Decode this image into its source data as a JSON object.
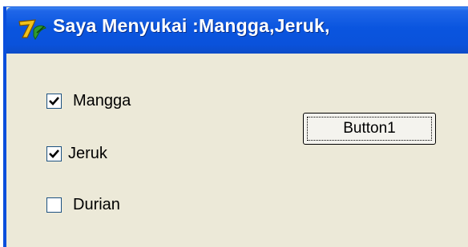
{
  "window": {
    "title": "Saya Menyukai :Mangga,Jeruk,",
    "icon": "delphi-app-icon"
  },
  "checkboxes": [
    {
      "label": "Mangga",
      "checked": true
    },
    {
      "label": "Jeruk",
      "checked": true
    },
    {
      "label": "Durian",
      "checked": false
    }
  ],
  "button": {
    "label": "Button1",
    "focused": true
  },
  "colors": {
    "titlebar": "#0a55df",
    "face": "#ece9d8",
    "checkbox_border": "#1c5180"
  }
}
